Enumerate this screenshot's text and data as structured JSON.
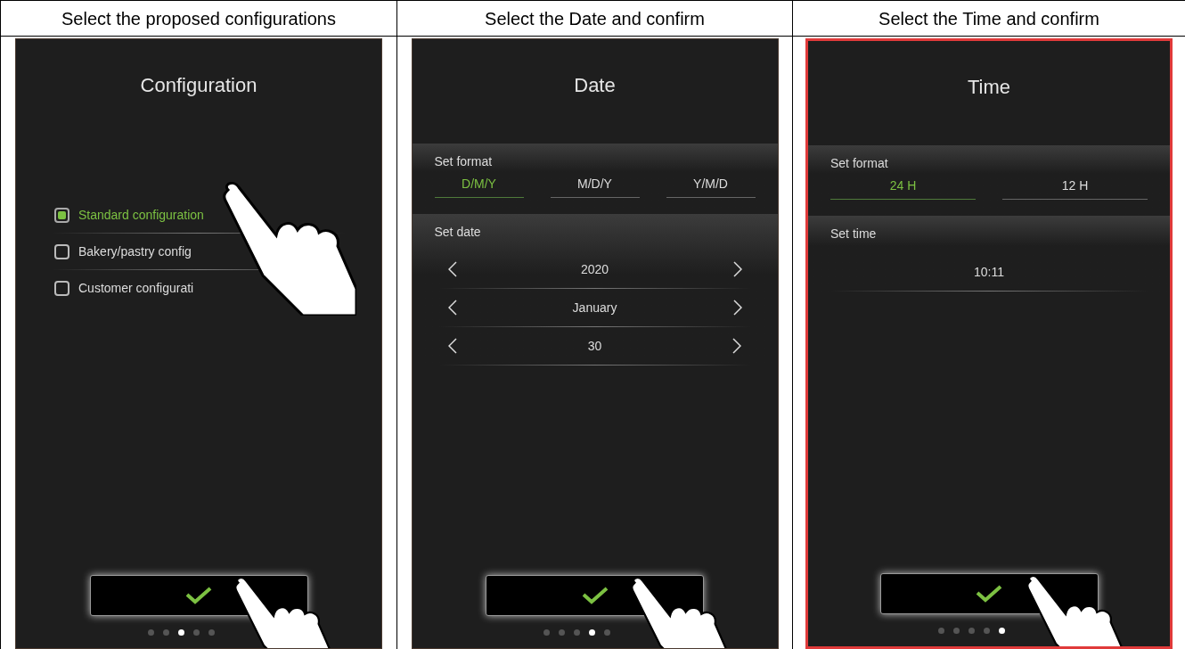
{
  "columns": [
    {
      "heading": "Select the proposed configurations",
      "highlighted": false,
      "screen": {
        "title": "Configuration",
        "sections": [
          {
            "kind": "checklist",
            "options": [
              {
                "label": "Standard configuration",
                "checked": true
              },
              {
                "label": "Bakery/pastry config",
                "checked": false
              },
              {
                "label": "Customer configurati",
                "checked": false
              }
            ]
          }
        ]
      },
      "page_dots": [
        {
          "selected": false
        },
        {
          "selected": false
        },
        {
          "selected": true
        },
        {
          "selected": false
        },
        {
          "selected": false
        }
      ]
    },
    {
      "heading": "Select the Date and confirm",
      "highlighted": false,
      "screen": {
        "title": "Date",
        "sections": [
          {
            "kind": "format",
            "label": "Set format",
            "options": [
              {
                "label": "D/M/Y",
                "selected": true
              },
              {
                "label": "M/D/Y",
                "selected": false
              },
              {
                "label": "Y/M/D",
                "selected": false
              }
            ]
          },
          {
            "kind": "stepper",
            "label": "Set date",
            "values": [
              "2020",
              "January",
              "30"
            ]
          }
        ]
      },
      "page_dots": [
        {
          "selected": false
        },
        {
          "selected": false
        },
        {
          "selected": false
        },
        {
          "selected": true
        },
        {
          "selected": false
        }
      ]
    },
    {
      "heading": "Select the Time and confirm",
      "highlighted": true,
      "screen": {
        "title": "Time",
        "sections": [
          {
            "kind": "format",
            "label": "Set format",
            "options": [
              {
                "label": "24 H",
                "selected": true
              },
              {
                "label": "12 H",
                "selected": false
              }
            ]
          },
          {
            "kind": "value",
            "label": "Set time",
            "value": "10:11"
          }
        ]
      },
      "page_dots": [
        {
          "selected": false
        },
        {
          "selected": false
        },
        {
          "selected": false
        },
        {
          "selected": false
        },
        {
          "selected": true
        }
      ]
    }
  ]
}
